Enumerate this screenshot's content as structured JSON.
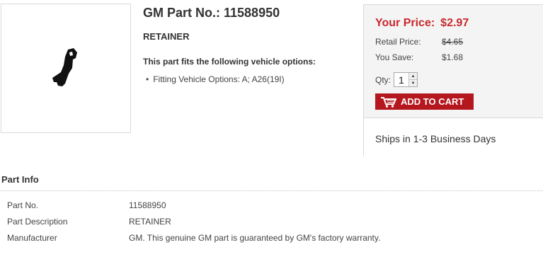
{
  "part": {
    "title": "GM Part No.: 11588950",
    "name": "RETAINER",
    "fits_heading": "This part fits the following vehicle options:",
    "fits": [
      "Fitting Vehicle Options: A; A26(19I)"
    ]
  },
  "price": {
    "your_price_label": "Your Price:",
    "your_price_value": "$2.97",
    "retail_label": "Retail Price:",
    "retail_value": "$4.65",
    "save_label": "You Save:",
    "save_value": "$1.68",
    "qty_label": "Qty:",
    "qty_value": "1",
    "add_to_cart_label": "ADD TO CART",
    "shipping": "Ships in 1-3 Business Days",
    "accent_color": "#c8282d",
    "button_color": "#b5171e"
  },
  "part_info": {
    "title": "Part Info",
    "rows": [
      {
        "label": "Part No.",
        "value": "11588950"
      },
      {
        "label": "Part Description",
        "value": "RETAINER"
      },
      {
        "label": "Manufacturer",
        "value": "GM. This genuine GM part is guaranteed by GM's factory warranty."
      }
    ]
  },
  "icons": {
    "cart": "shopping-cart-icon",
    "part_image": "retainer-part-image"
  }
}
